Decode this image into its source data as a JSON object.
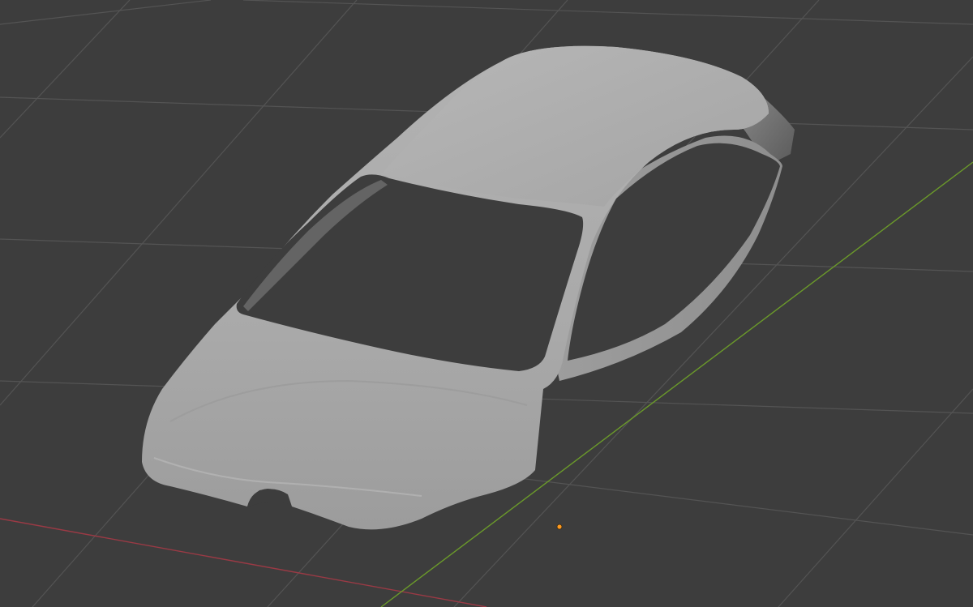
{
  "viewport": {
    "mode": "3D Viewport",
    "shading": "solid",
    "background_color": "#3d3d3d"
  },
  "grid": {
    "visible": true,
    "line_color": "#545454",
    "x_axis_color": "#9a3a45",
    "y_axis_color": "#6b9a2a"
  },
  "object": {
    "type": "mesh",
    "shape": "car-body-shell",
    "selected": false,
    "body_color": "#a9a9a9",
    "glass_opening_color": "#3d3d3d"
  },
  "origin": {
    "visible": true,
    "color": "#ff9a1f"
  }
}
